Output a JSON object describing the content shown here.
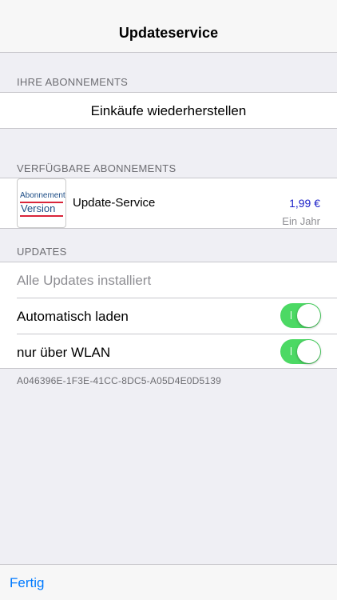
{
  "nav": {
    "title": "Updateservice"
  },
  "sections": {
    "subscriptions_header": "IHRE ABONNEMENTS",
    "restore_label": "Einkäufe wiederherstellen",
    "available_header": "VERFÜGBARE ABONNEMENTS",
    "updates_header": "UPDATES"
  },
  "subscription": {
    "icon": {
      "word1": "Abonnement",
      "word2": "Version"
    },
    "name": "Update-Service",
    "price": "1,99 €",
    "period": "Ein Jahr"
  },
  "updates": {
    "status": "Alle Updates installiert",
    "auto_load_label": "Automatisch laden",
    "auto_load_on": true,
    "wlan_only_label": "nur über WLAN",
    "wlan_only_on": true
  },
  "device_id": "A046396E-1F3E-41CC-8DC5-A05D4E0D5139",
  "toolbar": {
    "done_label": "Fertig"
  },
  "colors": {
    "accent": "#007aff",
    "switch_on": "#4cd964",
    "price": "#1a1fc8",
    "background": "#efeff4"
  }
}
